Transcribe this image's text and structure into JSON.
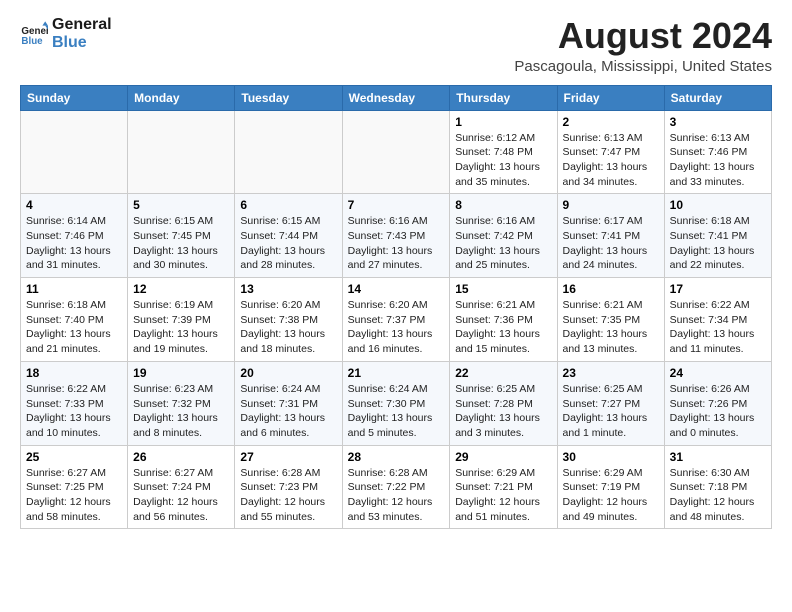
{
  "header": {
    "logo_line1": "General",
    "logo_line2": "Blue",
    "title": "August 2024",
    "subtitle": "Pascagoula, Mississippi, United States"
  },
  "calendar": {
    "days_of_week": [
      "Sunday",
      "Monday",
      "Tuesday",
      "Wednesday",
      "Thursday",
      "Friday",
      "Saturday"
    ],
    "weeks": [
      [
        {
          "day": "",
          "info": ""
        },
        {
          "day": "",
          "info": ""
        },
        {
          "day": "",
          "info": ""
        },
        {
          "day": "",
          "info": ""
        },
        {
          "day": "1",
          "info": "Sunrise: 6:12 AM\nSunset: 7:48 PM\nDaylight: 13 hours\nand 35 minutes."
        },
        {
          "day": "2",
          "info": "Sunrise: 6:13 AM\nSunset: 7:47 PM\nDaylight: 13 hours\nand 34 minutes."
        },
        {
          "day": "3",
          "info": "Sunrise: 6:13 AM\nSunset: 7:46 PM\nDaylight: 13 hours\nand 33 minutes."
        }
      ],
      [
        {
          "day": "4",
          "info": "Sunrise: 6:14 AM\nSunset: 7:46 PM\nDaylight: 13 hours\nand 31 minutes."
        },
        {
          "day": "5",
          "info": "Sunrise: 6:15 AM\nSunset: 7:45 PM\nDaylight: 13 hours\nand 30 minutes."
        },
        {
          "day": "6",
          "info": "Sunrise: 6:15 AM\nSunset: 7:44 PM\nDaylight: 13 hours\nand 28 minutes."
        },
        {
          "day": "7",
          "info": "Sunrise: 6:16 AM\nSunset: 7:43 PM\nDaylight: 13 hours\nand 27 minutes."
        },
        {
          "day": "8",
          "info": "Sunrise: 6:16 AM\nSunset: 7:42 PM\nDaylight: 13 hours\nand 25 minutes."
        },
        {
          "day": "9",
          "info": "Sunrise: 6:17 AM\nSunset: 7:41 PM\nDaylight: 13 hours\nand 24 minutes."
        },
        {
          "day": "10",
          "info": "Sunrise: 6:18 AM\nSunset: 7:41 PM\nDaylight: 13 hours\nand 22 minutes."
        }
      ],
      [
        {
          "day": "11",
          "info": "Sunrise: 6:18 AM\nSunset: 7:40 PM\nDaylight: 13 hours\nand 21 minutes."
        },
        {
          "day": "12",
          "info": "Sunrise: 6:19 AM\nSunset: 7:39 PM\nDaylight: 13 hours\nand 19 minutes."
        },
        {
          "day": "13",
          "info": "Sunrise: 6:20 AM\nSunset: 7:38 PM\nDaylight: 13 hours\nand 18 minutes."
        },
        {
          "day": "14",
          "info": "Sunrise: 6:20 AM\nSunset: 7:37 PM\nDaylight: 13 hours\nand 16 minutes."
        },
        {
          "day": "15",
          "info": "Sunrise: 6:21 AM\nSunset: 7:36 PM\nDaylight: 13 hours\nand 15 minutes."
        },
        {
          "day": "16",
          "info": "Sunrise: 6:21 AM\nSunset: 7:35 PM\nDaylight: 13 hours\nand 13 minutes."
        },
        {
          "day": "17",
          "info": "Sunrise: 6:22 AM\nSunset: 7:34 PM\nDaylight: 13 hours\nand 11 minutes."
        }
      ],
      [
        {
          "day": "18",
          "info": "Sunrise: 6:22 AM\nSunset: 7:33 PM\nDaylight: 13 hours\nand 10 minutes."
        },
        {
          "day": "19",
          "info": "Sunrise: 6:23 AM\nSunset: 7:32 PM\nDaylight: 13 hours\nand 8 minutes."
        },
        {
          "day": "20",
          "info": "Sunrise: 6:24 AM\nSunset: 7:31 PM\nDaylight: 13 hours\nand 6 minutes."
        },
        {
          "day": "21",
          "info": "Sunrise: 6:24 AM\nSunset: 7:30 PM\nDaylight: 13 hours\nand 5 minutes."
        },
        {
          "day": "22",
          "info": "Sunrise: 6:25 AM\nSunset: 7:28 PM\nDaylight: 13 hours\nand 3 minutes."
        },
        {
          "day": "23",
          "info": "Sunrise: 6:25 AM\nSunset: 7:27 PM\nDaylight: 13 hours\nand 1 minute."
        },
        {
          "day": "24",
          "info": "Sunrise: 6:26 AM\nSunset: 7:26 PM\nDaylight: 13 hours\nand 0 minutes."
        }
      ],
      [
        {
          "day": "25",
          "info": "Sunrise: 6:27 AM\nSunset: 7:25 PM\nDaylight: 12 hours\nand 58 minutes."
        },
        {
          "day": "26",
          "info": "Sunrise: 6:27 AM\nSunset: 7:24 PM\nDaylight: 12 hours\nand 56 minutes."
        },
        {
          "day": "27",
          "info": "Sunrise: 6:28 AM\nSunset: 7:23 PM\nDaylight: 12 hours\nand 55 minutes."
        },
        {
          "day": "28",
          "info": "Sunrise: 6:28 AM\nSunset: 7:22 PM\nDaylight: 12 hours\nand 53 minutes."
        },
        {
          "day": "29",
          "info": "Sunrise: 6:29 AM\nSunset: 7:21 PM\nDaylight: 12 hours\nand 51 minutes."
        },
        {
          "day": "30",
          "info": "Sunrise: 6:29 AM\nSunset: 7:19 PM\nDaylight: 12 hours\nand 49 minutes."
        },
        {
          "day": "31",
          "info": "Sunrise: 6:30 AM\nSunset: 7:18 PM\nDaylight: 12 hours\nand 48 minutes."
        }
      ]
    ]
  }
}
